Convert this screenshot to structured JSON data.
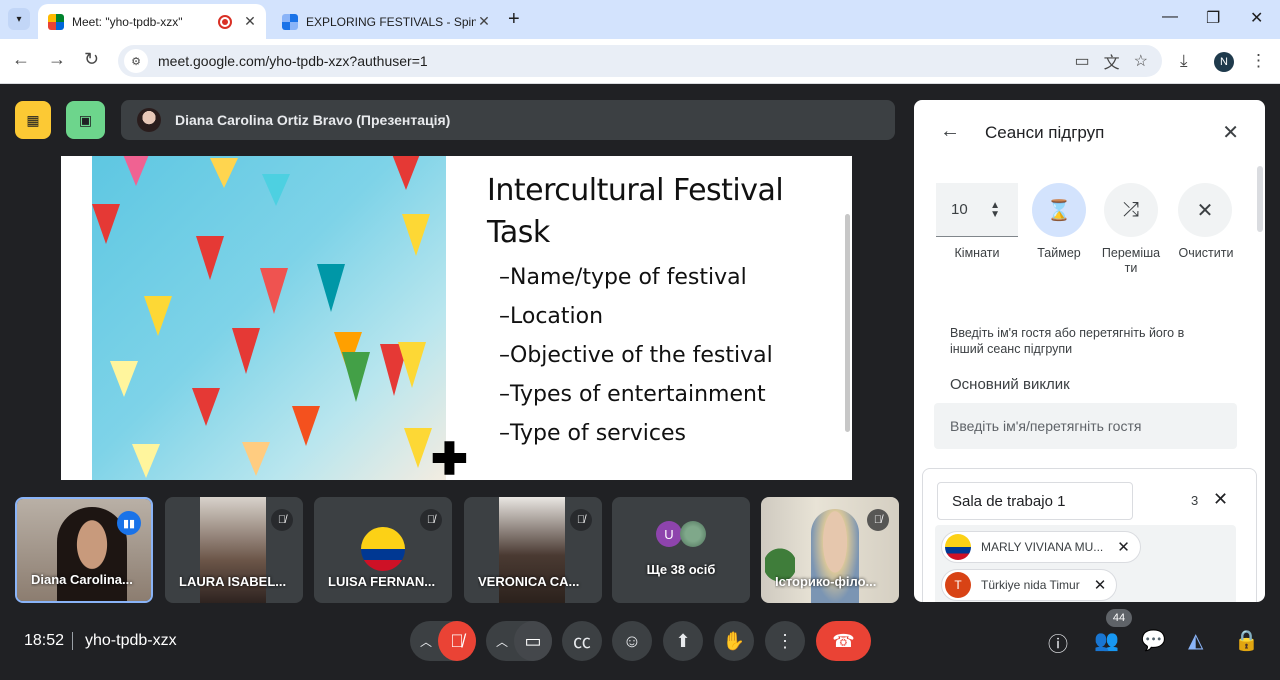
{
  "browser": {
    "tabs": [
      {
        "title": "Meet: \"yho-tpdb-xzx\"",
        "active": true,
        "recording": true
      },
      {
        "title": "EXPLORING FESTIVALS - Spin the whe",
        "active": false
      }
    ],
    "url": "meet.google.com/yho-tpdb-xzx?authuser=1",
    "profile_initial": "N"
  },
  "meet": {
    "presenter_label": "Diana Carolina Ortiz Bravo (Презентація)",
    "slide": {
      "title": "Intercultural Festival Task",
      "bullets": [
        "–Name/type of festival",
        "–Location",
        "–Objective of the festival",
        "–Types of entertainment",
        "–Type of services"
      ]
    },
    "tiles": [
      {
        "name": "Diana Carolina...",
        "speaking": true
      },
      {
        "name": "LAURA ISABEL...",
        "muted": true
      },
      {
        "name": "LUISA FERNAN...",
        "muted": true
      },
      {
        "name": "VERONICA CA...",
        "muted": true
      },
      {
        "name": "Ще 38 осіб",
        "avatar_letter": "U"
      },
      {
        "name": "Історико-філо...",
        "muted": true
      }
    ],
    "clock": "18:52",
    "meeting_code": "yho-tpdb-xzx",
    "people_count": "44"
  },
  "panel": {
    "title": "Сеанси підгруп",
    "rooms_value": "10",
    "labels": {
      "rooms": "Кімнати",
      "timer": "Таймер",
      "shuffle": "Переміша ти",
      "clear": "Очистити"
    },
    "hint": "Введіть ім'я гостя або перетягніть його в інший сеанс підгрупи",
    "main_call": "Основний виклик",
    "guest_placeholder": "Введіть ім'я/перетягніть гостя",
    "room": {
      "name": "Sala de trabajo 1",
      "count": "3",
      "members": [
        {
          "name": "MARLY VIVIANA MU...",
          "avatar": "flag-colombia"
        },
        {
          "name": "Türkiye nida Timur",
          "avatar_letter": "T",
          "avatar_color": "#d84315"
        }
      ]
    }
  },
  "colors": {
    "meet_bg": "#202124",
    "end_call": "#ea4335",
    "accent_blue": "#1a73e8",
    "yellow_btn": "#fcc934",
    "green_btn": "#6dd58c"
  }
}
